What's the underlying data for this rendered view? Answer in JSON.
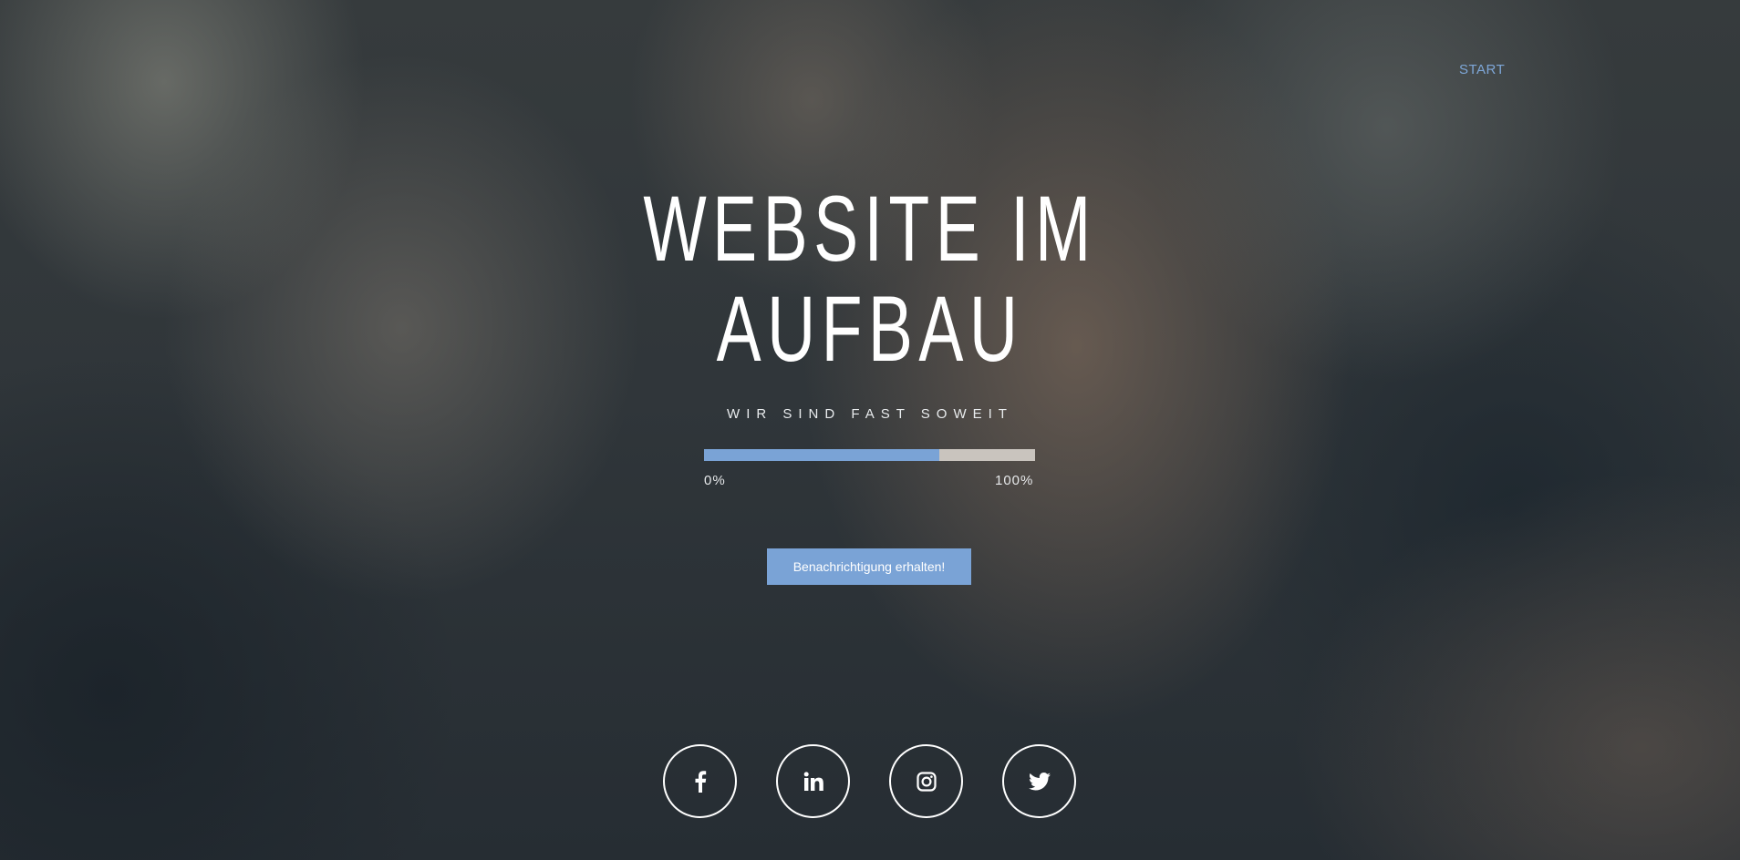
{
  "nav": {
    "start_label": "START"
  },
  "hero": {
    "title_line1": "WEBSITE IM",
    "title_line2": "AUFBAU",
    "subtitle": "WIR SIND FAST SOWEIT"
  },
  "progress": {
    "value_fraction": 0.71,
    "min_label": "0%",
    "max_label": "100%"
  },
  "cta": {
    "label": "Benachrichtigung erhalten!"
  },
  "social": [
    {
      "icon": "facebook-icon"
    },
    {
      "icon": "linkedin-icon"
    },
    {
      "icon": "instagram-icon"
    },
    {
      "icon": "twitter-icon"
    }
  ],
  "colors": {
    "accent": "#7aa3d6",
    "nav_link": "#7ea7d8",
    "track": "#c9c4be",
    "text": "#ffffff"
  }
}
